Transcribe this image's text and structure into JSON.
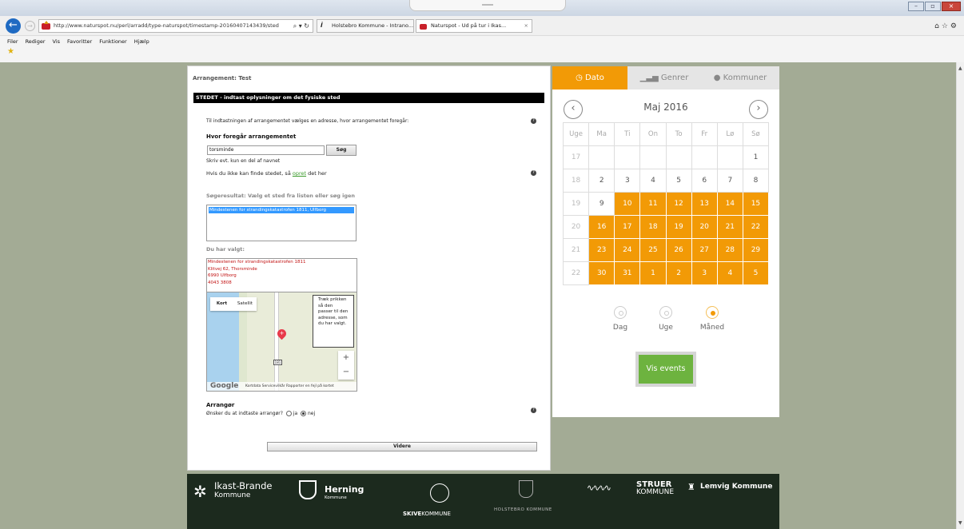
{
  "browser": {
    "address": "http://www.naturspot.nu/perl/arradd/type-naturspot/timestamp-20160407143439/sted",
    "address_domain": "naturspot.nu",
    "address_controls": "⌕ ▾ ↻",
    "tabs": [
      {
        "label": "Holstebro Kommune - Intrano..."
      },
      {
        "label": "Naturspot - Ud på tur i Ikas..."
      }
    ],
    "tab_close": "×",
    "menu": [
      "Filer",
      "Rediger",
      "Vis",
      "Favoritter",
      "Funktioner",
      "Hjælp"
    ],
    "colors": {
      "back_button": "#1f6ac2",
      "close_button": "#c9463b"
    }
  },
  "form": {
    "arrangement_title": "Arrangement: Test",
    "section_header": "STEDET - indtast oplysninger om det fysiske sted",
    "intro": "Til indtastningen af arrangementet vælges en adresse, hvor arrangementet foregår:",
    "where_heading": "Hvor foregår arrangementet",
    "search_value": "torsminde",
    "search_button": "Søg",
    "search_hint": "Skriv evt. kun en del af navnet",
    "notfound_prefix": "Hvis du ikke kan finde stedet, så",
    "notfound_link": "opret",
    "notfound_suffix": "det her",
    "result_heading": "Søgeresultat: Vælg et sted fra listen eller søg igen",
    "result_item": "Mindestenen for strandingskatastrofen 1811, Ulfborg",
    "chosen_heading": "Du har valgt:",
    "chosen_lines": [
      "Mindestenen for strandingskatastrofen 1811",
      "Klitvej 62, Thorsminde",
      "6990 Ulfborg",
      "4043 3808"
    ],
    "organizer_heading": "Arrangør",
    "organizer_question": "Ønsker du at indtaste arrangør?",
    "opt_yes": "ja",
    "opt_no": "nej",
    "next_button": "Videre",
    "info_icon_glyph": "?"
  },
  "map": {
    "type_map": "Kort",
    "type_satellite": "Satellit",
    "tooltip": "Træk prikken så den passer til den adresse, som du har valgt.",
    "zoom_in": "+",
    "zoom_out": "−",
    "road_number": "181",
    "google": "Google",
    "footer": "Kortdata   Servicevilkår   Rapporter en fejl på kortet",
    "colors": {
      "sea": "#a9d2ee",
      "pin": "#e8394a"
    }
  },
  "calendar": {
    "tabs": [
      {
        "label": "Dato",
        "icon": "clock-icon",
        "active": true
      },
      {
        "label": "Genrer",
        "icon": "bar-chart-icon",
        "active": false
      },
      {
        "label": "Kommuner",
        "icon": "globe-icon",
        "active": false
      }
    ],
    "month": "Maj 2016",
    "prev": "‹",
    "next": "›",
    "headers": [
      "Uge",
      "Ma",
      "Ti",
      "On",
      "To",
      "Fr",
      "Lø",
      "Sø"
    ],
    "weeks": [
      {
        "wk": "17",
        "days": [
          "",
          "",
          "",
          "",
          "",
          "",
          "1"
        ],
        "highlight_from": 7
      },
      {
        "wk": "18",
        "days": [
          "2",
          "3",
          "4",
          "5",
          "6",
          "7",
          "8"
        ],
        "highlight_from": 7
      },
      {
        "wk": "19",
        "days": [
          "9",
          "10",
          "11",
          "12",
          "13",
          "14",
          "15"
        ],
        "highlight_from": 1
      },
      {
        "wk": "20",
        "days": [
          "16",
          "17",
          "18",
          "19",
          "20",
          "21",
          "22"
        ],
        "highlight_from": 0
      },
      {
        "wk": "21",
        "days": [
          "23",
          "24",
          "25",
          "26",
          "27",
          "28",
          "29"
        ],
        "highlight_from": 0
      },
      {
        "wk": "22",
        "days": [
          "30",
          "31",
          "1",
          "2",
          "3",
          "4",
          "5"
        ],
        "highlight_from": 0
      }
    ],
    "views": [
      {
        "label": "Dag",
        "selected": false
      },
      {
        "label": "Uge",
        "selected": false
      },
      {
        "label": "Måned",
        "selected": true
      }
    ],
    "show_button": "Vis events",
    "colors": {
      "accent": "#f29a06",
      "button": "#6db33f"
    }
  },
  "footer": {
    "ikast_name": "Ikast-Brande",
    "ikast_sub": "Kommune",
    "herning_name": "Herning",
    "herning_sub": "Kommune",
    "skive_a": "SKIVE",
    "skive_b": "KOMMUNE",
    "holstebro": "HOLSTEBRO KOMMUNE",
    "struer_a": "STRUER",
    "struer_b": "KOMMUNE",
    "lemvig": "Lemvig Kommune",
    "background": "#1c2a1e"
  }
}
